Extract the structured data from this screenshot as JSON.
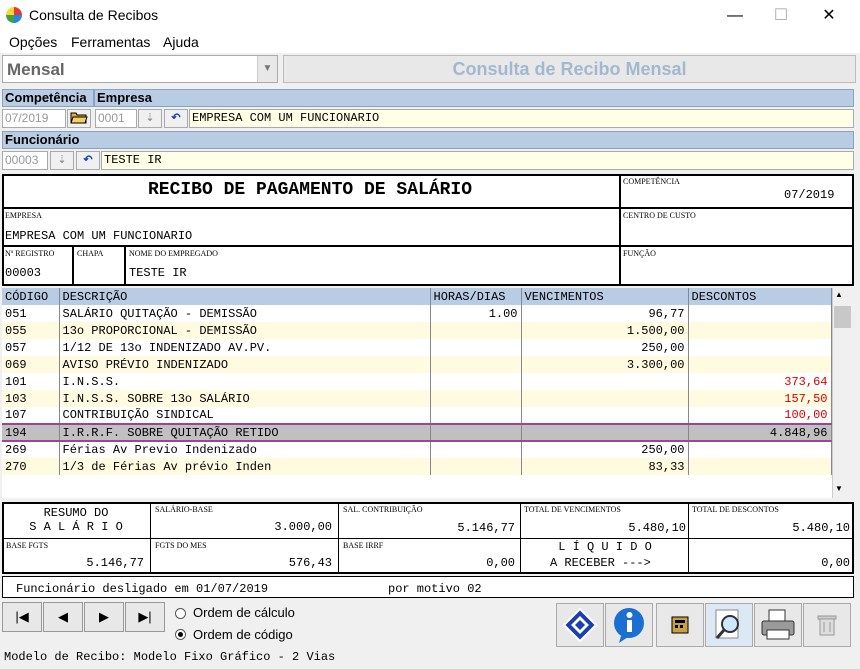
{
  "window": {
    "title": "Consulta de Recibos",
    "minimize": "—",
    "maximize": "☐",
    "close": "✕"
  },
  "menu": [
    "Opções",
    "Ferramentas",
    "Ajuda"
  ],
  "mode_select": {
    "value": "Mensal"
  },
  "header_title": "Consulta de Recibo Mensal",
  "filters": {
    "competencia_label": "Competência",
    "competencia_value": "07/2019",
    "empresa_label": "Empresa",
    "empresa_code": "0001",
    "empresa_name": "EMPRESA COM UM FUNCIONARIO",
    "funcionario_label": "Funcionário",
    "funcionario_code": "00003",
    "funcionario_name": "TESTE IR"
  },
  "receipt": {
    "title": "RECIBO DE PAGAMENTO DE SALÁRIO",
    "competencia_label": "COMPETÊNCIA",
    "competencia_value": "07/2019",
    "empresa_label": "EMPRESA",
    "empresa_value": "EMPRESA COM UM FUNCIONARIO",
    "centro_label": "CENTRO DE CUSTO",
    "registro_label": "Nº REGISTRO",
    "registro_value": "00003",
    "chapa_label": "CHAPA",
    "nome_label": "NOME DO EMPREGADO",
    "nome_value": "TESTE IR",
    "funcao_label": "FUNÇÃO"
  },
  "table": {
    "headers": [
      "CÓDIGO",
      "DESCRIÇÃO",
      "HORAS/DIAS",
      "VENCIMENTOS",
      "DESCONTOS"
    ],
    "rows": [
      [
        "051",
        "SALÁRIO QUITAÇÃO - DEMISSÃO",
        "1.00",
        "96,77",
        ""
      ],
      [
        "055",
        "13o PROPORCIONAL - DEMISSÃO",
        "",
        "1.500,00",
        ""
      ],
      [
        "057",
        "1/12 DE 13o INDENIZADO AV.PV.",
        "",
        "250,00",
        ""
      ],
      [
        "069",
        "AVISO PRÉVIO INDENIZADO",
        "",
        "3.300,00",
        ""
      ],
      [
        "101",
        "I.N.S.S.",
        "",
        "",
        "373,64"
      ],
      [
        "103",
        "I.N.S.S. SOBRE 13o SALÁRIO",
        "",
        "",
        "157,50"
      ],
      [
        "107",
        "CONTRIBUIÇÃO SINDICAL",
        "",
        "",
        "100,00"
      ],
      [
        "194",
        "I.R.R.F. SOBRE QUITAÇÃO RETIDO",
        "",
        "",
        "4.848,96"
      ],
      [
        "269",
        "Férias Av Previo Indenizado",
        "",
        "250,00",
        ""
      ],
      [
        "270",
        "1/3 de Férias Av prévio Inden",
        "",
        "83,33",
        ""
      ]
    ]
  },
  "summary": {
    "resumo_line1": "RESUMO DO",
    "resumo_line2": "S A L Á R I O",
    "salario_base_label": "SALÁRIO-BASE",
    "salario_base_value": "3.000,00",
    "sal_contrib_label": "SAL. CONTRIBUIÇÃO",
    "sal_contrib_value": "5.146,77",
    "total_venc_label": "TOTAL DE VENCIMENTOS",
    "total_venc_value": "5.480,10",
    "total_desc_label": "TOTAL DE DESCONTOS",
    "total_desc_value": "5.480,10",
    "base_fgts_label": "BASE FGTS",
    "base_fgts_value": "5.146,77",
    "fgts_mes_label": "FGTS DO MES",
    "fgts_mes_value": "576,43",
    "base_irrf_label": "BASE IRRF",
    "base_irrf_value": "0,00",
    "liquido_line1": "L Í Q U I D O",
    "liquido_line2": "A RECEBER --->",
    "liquido_value": "0,00"
  },
  "status_note": "Funcionário desligado em 01/07/2019",
  "status_motivo": "por motivo 02",
  "nav": {
    "first": "|◀",
    "prev": "◀",
    "next": "▶",
    "last": "▶|"
  },
  "order": {
    "opt1": "Ordem de cálculo",
    "opt2": "Ordem de código",
    "selected": "opt2"
  },
  "footer": "Modelo de Recibo: Modelo Fixo Gráfico - 2 Vias"
}
